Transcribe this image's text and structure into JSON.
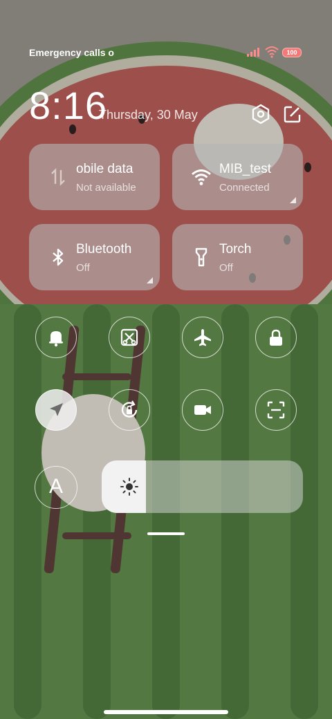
{
  "status_bar": {
    "carrier_text": "Emergency calls o",
    "battery": "100",
    "icons": [
      "signal-icon",
      "wifi-icon",
      "battery-icon"
    ]
  },
  "header": {
    "time": "8:16",
    "date": "Thursday, 30 May",
    "icons": [
      "settings-icon",
      "edit-icon"
    ]
  },
  "tiles": [
    {
      "title": "obile data",
      "subtitle": "Not available",
      "icon": "mobile-data-icon"
    },
    {
      "title": "MIB_test",
      "subtitle": "Connected",
      "icon": "wifi-icon"
    },
    {
      "title": "Bluetooth",
      "subtitle": "Off",
      "icon": "bluetooth-icon"
    },
    {
      "title": "Torch",
      "subtitle": "Off",
      "icon": "torch-icon"
    }
  ],
  "toggles_row1": [
    "bell-icon",
    "screenshot-icon",
    "airplane-icon",
    "lock-icon"
  ],
  "toggles_row2": [
    "location-icon",
    "rotation-lock-icon",
    "video-icon",
    "scan-icon"
  ],
  "font_button": "A",
  "brightness_level": 0.22,
  "colors": {
    "tile_bg": "#b4b4b4",
    "active_toggle_bg": "#f0f0f0",
    "battery": "#ff7878"
  }
}
